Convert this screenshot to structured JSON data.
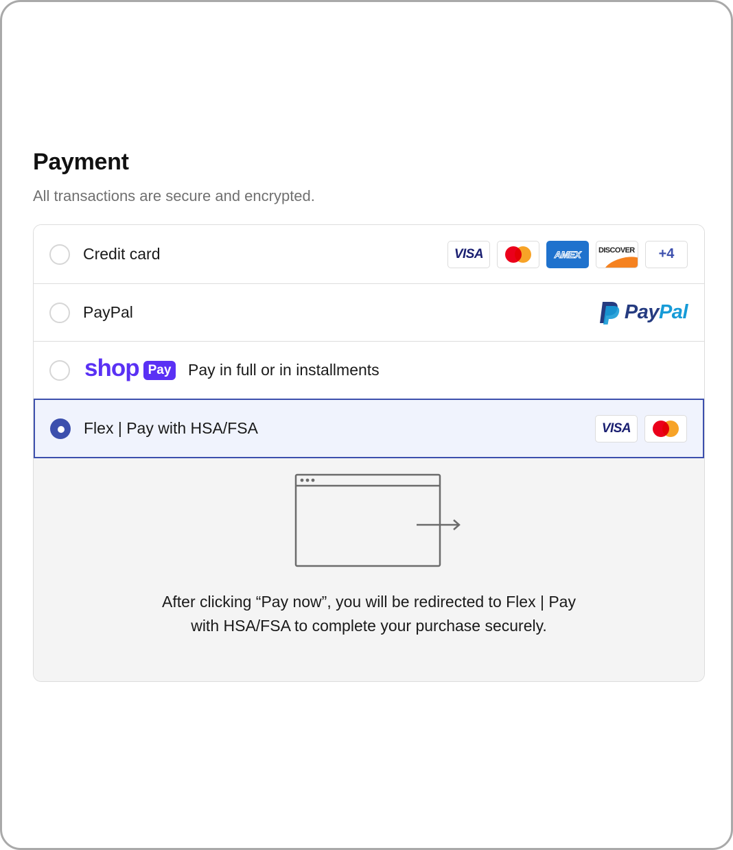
{
  "payment": {
    "title": "Payment",
    "subtitle": "All transactions are secure and encrypted."
  },
  "options": {
    "credit_card": {
      "label": "Credit card",
      "selected": false,
      "brands": [
        "visa-icon",
        "mastercard-icon",
        "amex-icon",
        "discover-icon"
      ],
      "visa_text": "VISA",
      "amex_text": "AMEX",
      "discover_text": "DISCOVER",
      "more_badge": "+4"
    },
    "paypal": {
      "label": "PayPal",
      "selected": false,
      "logo_pay": "Pay",
      "logo_pal": "Pal"
    },
    "shop_pay": {
      "logo_shop": "shop",
      "logo_pay": "Pay",
      "description": "Pay in full or in installments",
      "selected": false
    },
    "flex": {
      "label": "Flex | Pay with HSA/FSA",
      "selected": true,
      "visa_text": "VISA",
      "brands": [
        "visa-icon",
        "mastercard-icon"
      ]
    }
  },
  "redirect_panel": {
    "icon": "browser-redirect-icon",
    "message": "After clicking “Pay now”, you will be redirected to Flex | Pay with HSA/FSA to complete your purchase securely."
  },
  "colors": {
    "accent": "#3c4fad",
    "selected_bg": "#f0f3fd",
    "panel_bg": "#f4f4f4",
    "shop_purple": "#5a31f4",
    "paypal_dark": "#253b80",
    "paypal_light": "#179bd7"
  }
}
